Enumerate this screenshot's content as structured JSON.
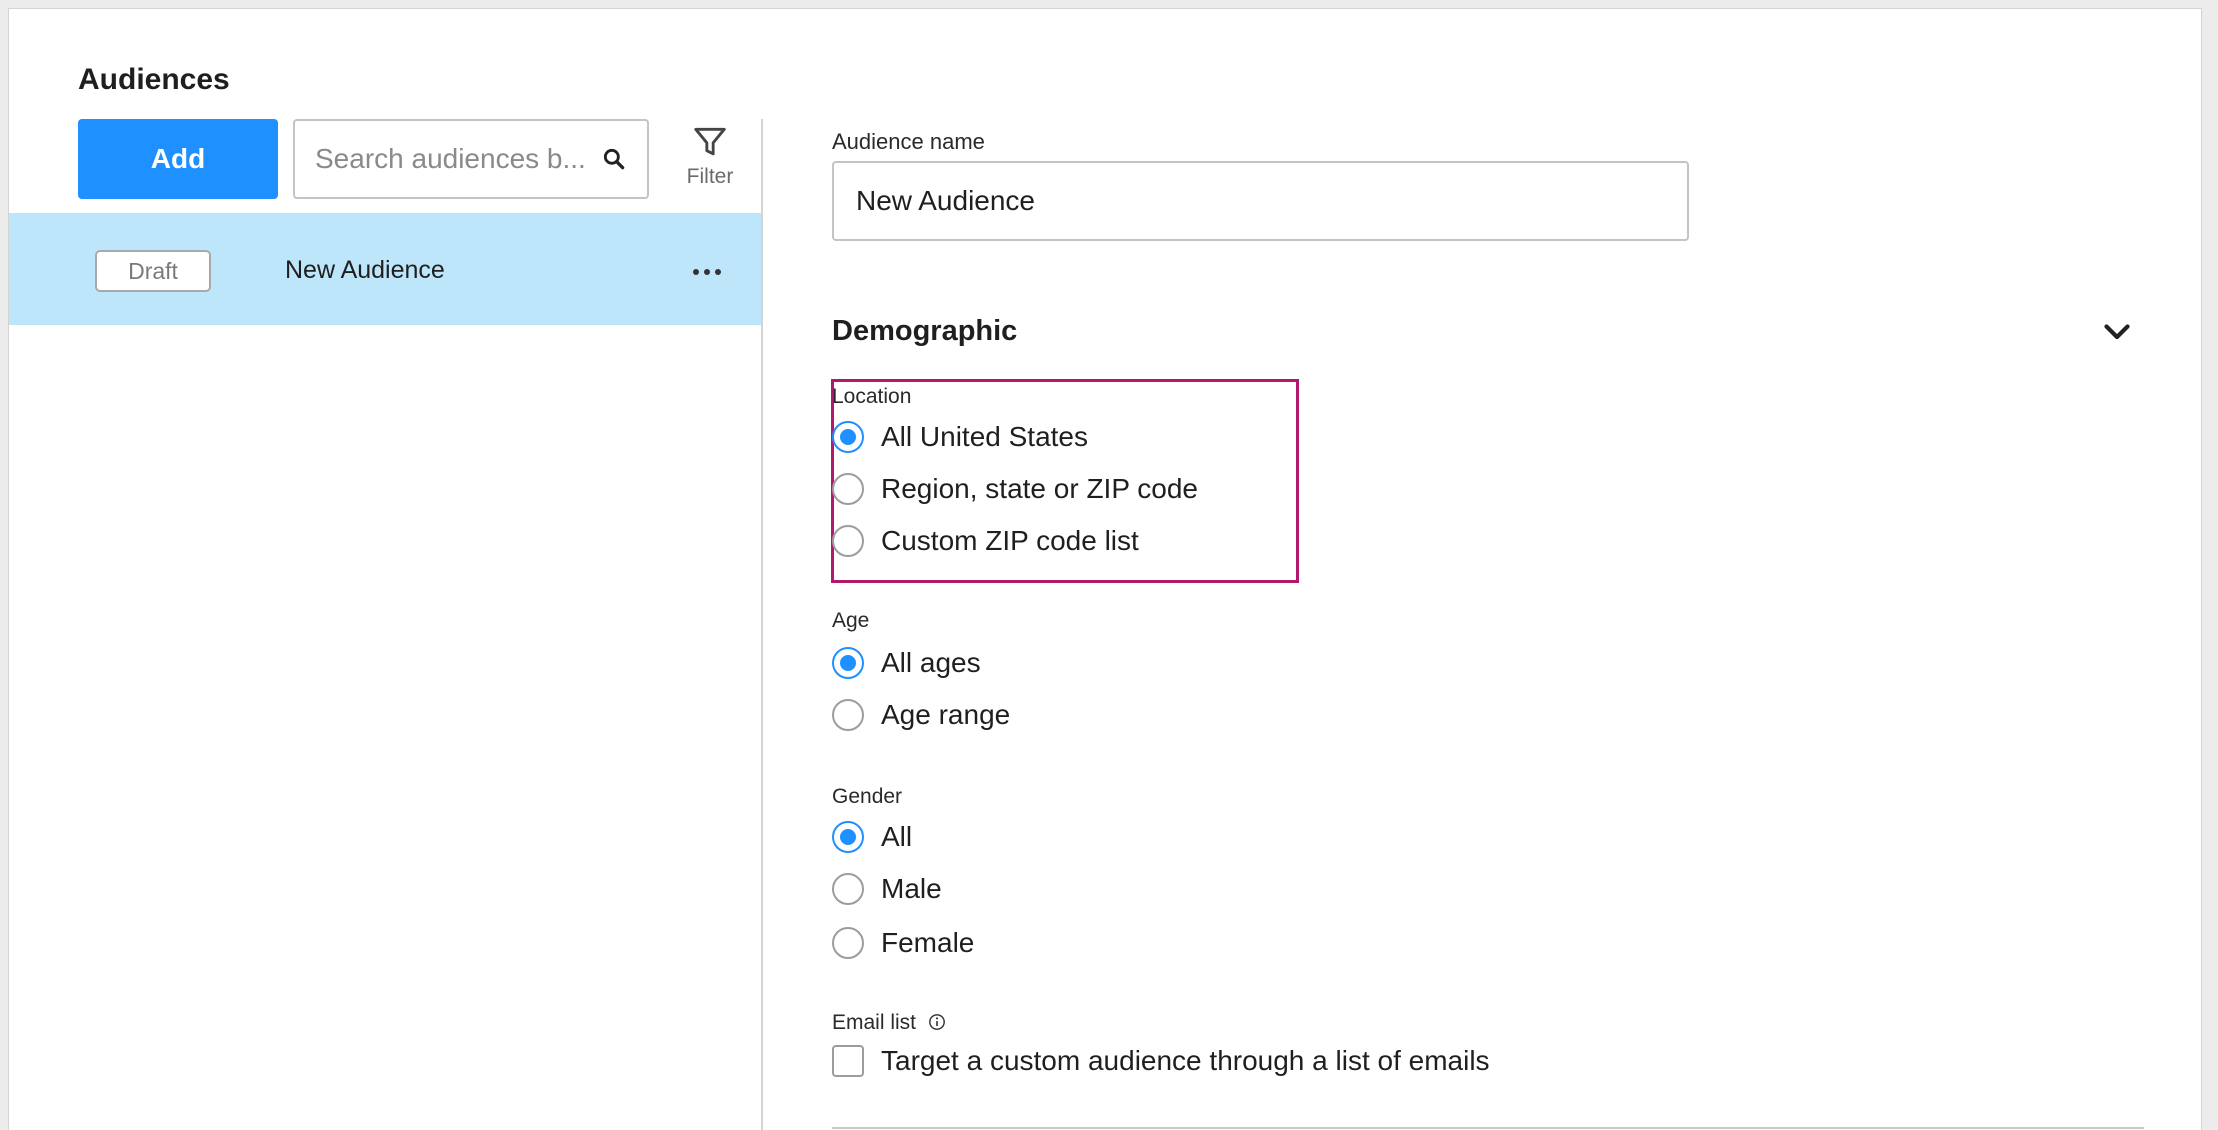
{
  "sidebar": {
    "title": "Audiences",
    "add_label": "Add",
    "search_placeholder": "Search audiences b...",
    "filter_label": "Filter",
    "items": [
      {
        "status": "Draft",
        "name": "New Audience"
      }
    ]
  },
  "form": {
    "name_label": "Audience name",
    "name_value": "New Audience",
    "section_title": "Demographic",
    "location": {
      "label": "Location",
      "options": [
        "All United States",
        "Region, state or ZIP code",
        "Custom ZIP code list"
      ],
      "selected": "All United States"
    },
    "age": {
      "label": "Age",
      "options": [
        "All ages",
        "Age range"
      ],
      "selected": "All ages"
    },
    "gender": {
      "label": "Gender",
      "options": [
        "All",
        "Male",
        "Female"
      ],
      "selected": "All"
    },
    "email_list": {
      "label": "Email list",
      "checkbox_label": "Target a custom audience through a list of emails",
      "checked": false
    }
  },
  "colors": {
    "accent": "#1e90ff",
    "selected_row": "#bde6fb",
    "highlight": "#b0196e"
  }
}
